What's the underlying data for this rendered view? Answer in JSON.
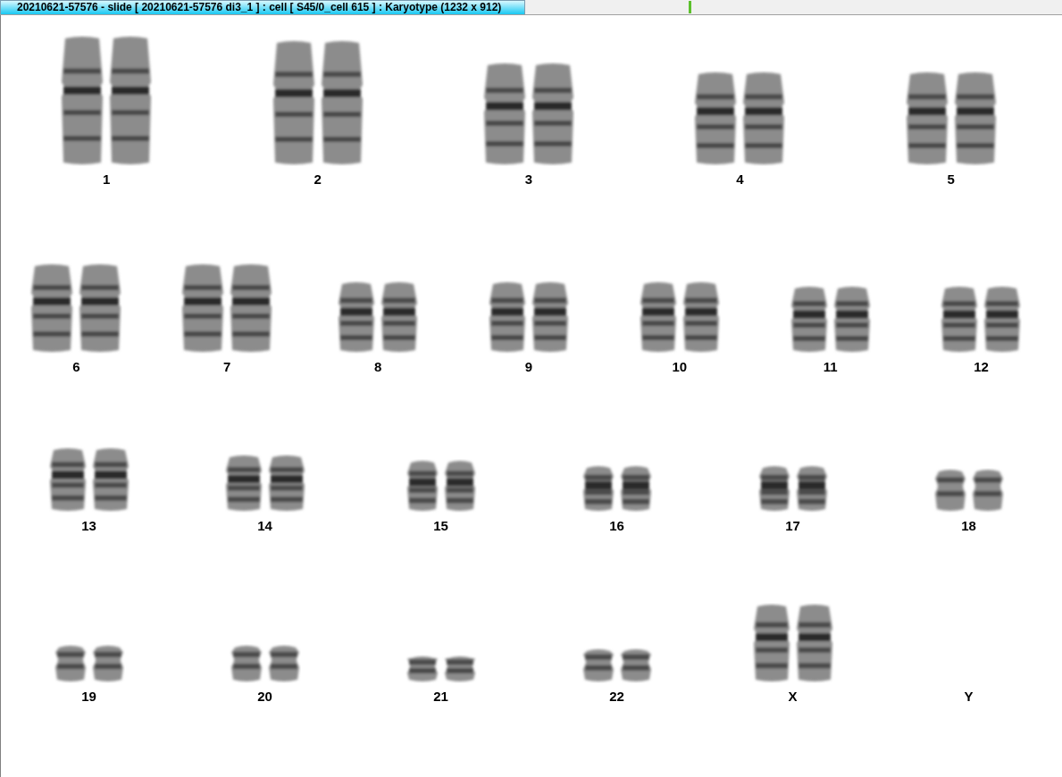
{
  "window": {
    "tab_title": "20210621-57576 - slide [ 20210621-57576 di3_1 ] : cell [ S45/0_cell 615 ] : Karyotype  (1232 x 912)"
  },
  "karyotype": {
    "rows": [
      [
        {
          "label": "1",
          "kind": "pair"
        },
        {
          "label": "2",
          "kind": "pair"
        },
        {
          "label": "3",
          "kind": "pair"
        },
        {
          "label": "4",
          "kind": "pair"
        },
        {
          "label": "5",
          "kind": "pair"
        }
      ],
      [
        {
          "label": "6",
          "kind": "pair"
        },
        {
          "label": "7",
          "kind": "pair"
        },
        {
          "label": "8",
          "kind": "pair"
        },
        {
          "label": "9",
          "kind": "pair"
        },
        {
          "label": "10",
          "kind": "pair"
        },
        {
          "label": "11",
          "kind": "pair"
        },
        {
          "label": "12",
          "kind": "pair"
        }
      ],
      [
        {
          "label": "13",
          "kind": "pair"
        },
        {
          "label": "14",
          "kind": "pair"
        },
        {
          "label": "15",
          "kind": "pair"
        },
        {
          "label": "16",
          "kind": "pair"
        },
        {
          "label": "17",
          "kind": "pair"
        },
        {
          "label": "18",
          "kind": "pair"
        }
      ],
      [
        {
          "label": "19",
          "kind": "pair"
        },
        {
          "label": "20",
          "kind": "pair"
        },
        {
          "label": "21",
          "kind": "pair"
        },
        {
          "label": "22",
          "kind": "pair"
        },
        {
          "label": "X",
          "kind": "pair"
        },
        {
          "label": "Y",
          "kind": "empty"
        }
      ]
    ]
  }
}
